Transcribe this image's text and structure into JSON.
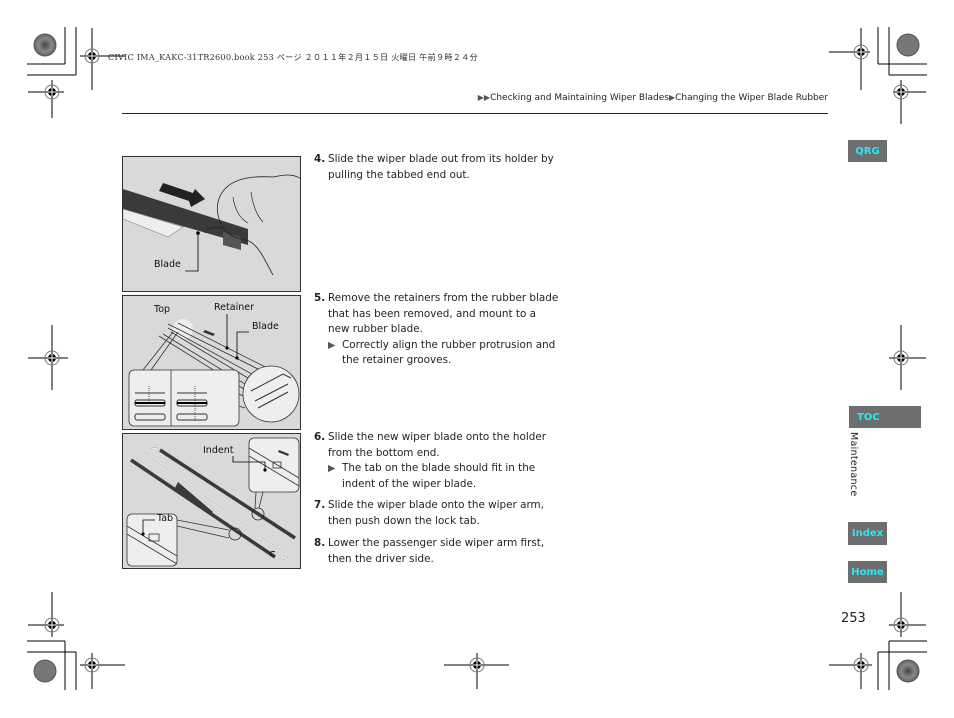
{
  "print_info": {
    "text": "CIVIC IMA_KAKC-31TR2600.book  253 ページ  ２０１１年２月１５日  火曜日  午前９時２４分"
  },
  "breadcrumb": {
    "prefix_icon": "double-triangle-right-icon",
    "items": [
      "Checking and Maintaining Wiper Blades",
      "Changing the Wiper Blade Rubber"
    ],
    "separator_icon": "triangle-right-icon"
  },
  "figures": [
    {
      "name": "figure-slide-out-blade",
      "labels": [
        "Blade"
      ]
    },
    {
      "name": "figure-remove-retainers",
      "labels": [
        "Top",
        "Retainer",
        "Blade"
      ]
    },
    {
      "name": "figure-slide-new-blade",
      "labels": [
        "Indent",
        "Tab"
      ]
    }
  ],
  "steps": [
    {
      "num": "4.",
      "text": "Slide the wiper blade out from its holder by pulling the tabbed end out.",
      "notes": []
    },
    {
      "num": "5.",
      "text": "Remove the retainers from the rubber blade that has been removed, and mount to a new rubber blade.",
      "notes": [
        "Correctly align the rubber protrusion and the retainer grooves."
      ]
    },
    {
      "num": "6.",
      "text": "Slide the new wiper blade onto the holder from the bottom end.",
      "notes": [
        "The tab on the blade should fit in the indent of the wiper blade."
      ]
    },
    {
      "num": "7.",
      "text": "Slide the wiper blade onto the wiper arm, then push down the lock tab.",
      "notes": []
    },
    {
      "num": "8.",
      "text": "Lower the passenger side wiper arm first, then the driver side.",
      "notes": []
    }
  ],
  "nav": {
    "qrg": "QRG",
    "toc": "TOC",
    "section": "Maintenance",
    "index": "Index",
    "home": "Home"
  },
  "colors": {
    "nav_bg": "#6d6e70",
    "nav_text": "#2ee8f0",
    "figure_bg": "#d9d9d9"
  },
  "page_number": "253"
}
